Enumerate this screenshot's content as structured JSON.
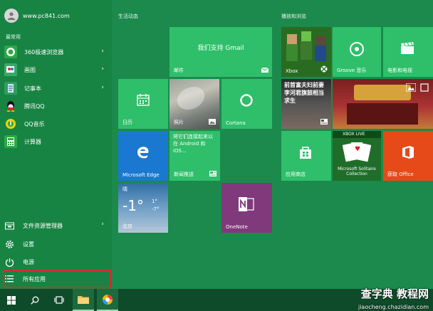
{
  "account": {
    "name": "www.pc841.com"
  },
  "sections": {
    "most_used": "最常用"
  },
  "apps": [
    {
      "label": "360极速浏览器",
      "icon": "360-browser-icon"
    },
    {
      "label": "画图",
      "icon": "paint-icon"
    },
    {
      "label": "记事本",
      "icon": "notepad-icon"
    },
    {
      "label": "腾讯QQ",
      "icon": "qq-icon"
    },
    {
      "label": "QQ音乐",
      "icon": "qq-music-icon"
    },
    {
      "label": "计算器",
      "icon": "calculator-icon"
    }
  ],
  "system": {
    "file_explorer": "文件资源管理器",
    "settings": "设置",
    "power": "电源",
    "all_apps": "所有应用"
  },
  "groups": {
    "life": "生活动态",
    "play": "播放和浏览"
  },
  "tiles": {
    "mail_text": "我们支持 Gmail",
    "mail": "邮件",
    "calendar": "日历",
    "photos": "照片",
    "cortana": "Cortana",
    "edge": "Microsoft Edge",
    "news_text": "将它们连接起来以在 Android 和 iOS...",
    "news": "新闻推送",
    "weather_city": "北京",
    "weather_temp": "-1°",
    "weather_hi": "1°",
    "weather_lo": "-7°",
    "weather_cond": "晴",
    "onenote": "OneNote",
    "xbox": "Xbox",
    "groove": "Groove 音乐",
    "movies": "电影和电视",
    "news_headline": "前首富夫妇前妻李河君旗鼓相当求生",
    "store": "应用商店",
    "solitaire": "Microsoft Solitaire Collection",
    "xbox_live": "XBOX LIVE",
    "office": "获取 Office"
  },
  "watermark": {
    "title": "查字典 教程网",
    "url": "jiaocheng.chazidian.com"
  },
  "colors": {
    "accent": "#1b8a4c",
    "tile": "#2fbf6a",
    "edge_blue": "#1a78d0",
    "onenote_purple": "#80397b",
    "office_orange": "#e64a19",
    "highlight": "#d62c2c"
  }
}
